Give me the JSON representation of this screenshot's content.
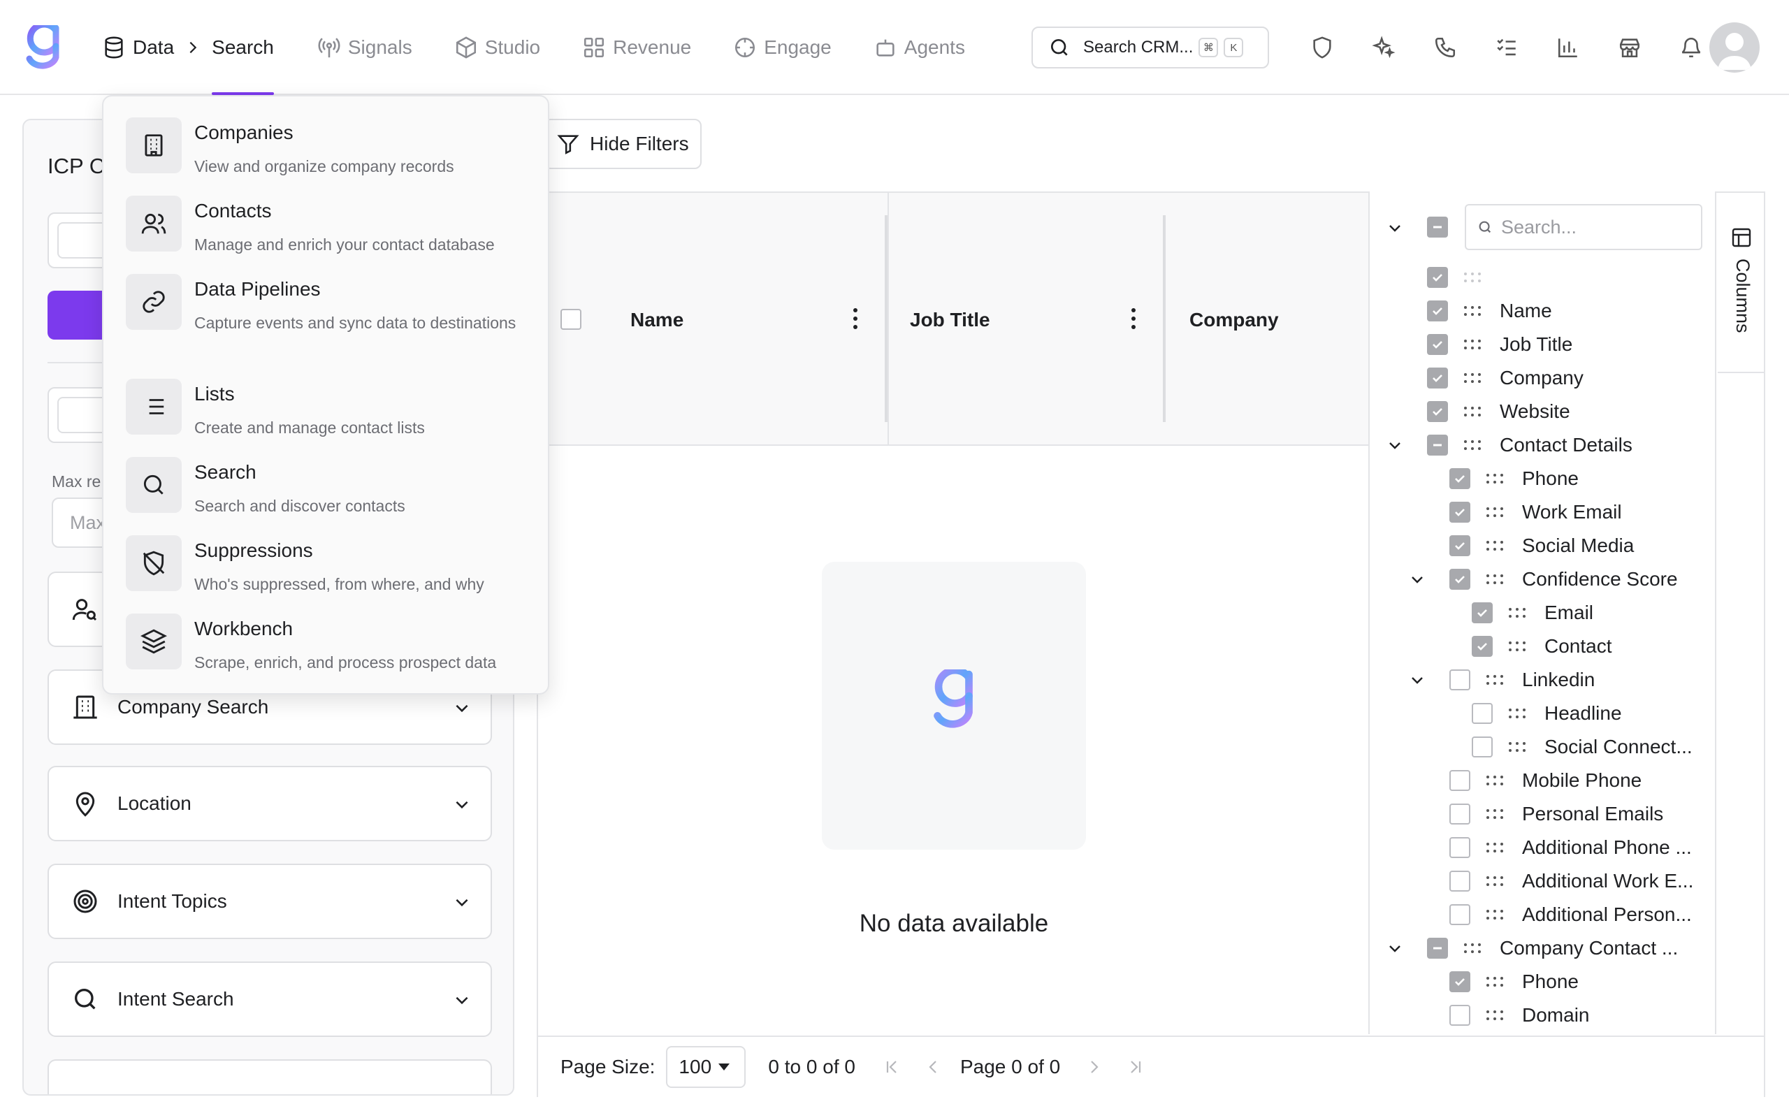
{
  "nav": {
    "data_label": "Data",
    "search_label": "Search",
    "signals_label": "Signals",
    "studio_label": "Studio",
    "revenue_label": "Revenue",
    "engage_label": "Engage",
    "agents_label": "Agents"
  },
  "global_search": {
    "placeholder": "Search CRM...",
    "key_cmd": "⌘",
    "key_k": "K"
  },
  "colors": {
    "accent": "#7c3aed"
  },
  "menu": {
    "items": [
      {
        "title": "Companies",
        "desc": "View and organize company records",
        "icon": "building-icon"
      },
      {
        "title": "Contacts",
        "desc": "Manage and enrich your contact database",
        "icon": "users-icon"
      },
      {
        "title": "Data Pipelines",
        "desc": "Capture events and sync data to destinations",
        "icon": "link-icon"
      },
      {
        "title": "Lists",
        "desc": "Create and manage contact lists",
        "icon": "list-icon"
      },
      {
        "title": "Search",
        "desc": "Search and discover contacts",
        "icon": "search-icon"
      },
      {
        "title": "Suppressions",
        "desc": "Who's suppressed, from where, and why",
        "icon": "shield-off-icon"
      },
      {
        "title": "Workbench",
        "desc": "Scrape, enrich, and process prospect data",
        "icon": "layers-icon"
      }
    ]
  },
  "filters": {
    "title": "ICP C",
    "max_label": "Max re",
    "max_placeholder": "Max",
    "company_search": "Company Search",
    "location": "Location",
    "intent_topics": "Intent Topics",
    "intent_search": "Intent Search"
  },
  "toolbar": {
    "hide_filters": "Hide Filters"
  },
  "grid": {
    "columns": [
      "Name",
      "Job Title",
      "Company"
    ],
    "empty_text": "No data available"
  },
  "pager": {
    "page_size_label": "Page Size:",
    "page_size": "100",
    "range": "0 to 0 of 0",
    "page": "Page 0 of 0"
  },
  "columns_panel": {
    "tab_label": "Columns",
    "search_placeholder": "Search...",
    "items": [
      {
        "label": "",
        "level": 0,
        "state": "on",
        "expand": false
      },
      {
        "label": "Name",
        "level": 0,
        "state": "on",
        "expand": false
      },
      {
        "label": "Job Title",
        "level": 0,
        "state": "on",
        "expand": false
      },
      {
        "label": "Company",
        "level": 0,
        "state": "on",
        "expand": false
      },
      {
        "label": "Website",
        "level": 0,
        "state": "on",
        "expand": false
      },
      {
        "label": "Contact Details",
        "level": 0,
        "state": "mix",
        "expand": true
      },
      {
        "label": "Phone",
        "level": 1,
        "state": "on",
        "expand": false
      },
      {
        "label": "Work Email",
        "level": 1,
        "state": "on",
        "expand": false
      },
      {
        "label": "Social Media",
        "level": 1,
        "state": "on",
        "expand": false
      },
      {
        "label": "Confidence Score",
        "level": 1,
        "state": "on",
        "expand": true
      },
      {
        "label": "Email",
        "level": 2,
        "state": "on",
        "expand": false
      },
      {
        "label": "Contact",
        "level": 2,
        "state": "on",
        "expand": false
      },
      {
        "label": "Linkedin",
        "level": 1,
        "state": "off",
        "expand": true
      },
      {
        "label": "Headline",
        "level": 2,
        "state": "off",
        "expand": false
      },
      {
        "label": "Social Connect...",
        "level": 2,
        "state": "off",
        "expand": false
      },
      {
        "label": "Mobile Phone",
        "level": 1,
        "state": "off",
        "expand": false
      },
      {
        "label": "Personal Emails",
        "level": 1,
        "state": "off",
        "expand": false
      },
      {
        "label": "Additional Phone ...",
        "level": 1,
        "state": "off",
        "expand": false
      },
      {
        "label": "Additional Work E...",
        "level": 1,
        "state": "off",
        "expand": false
      },
      {
        "label": "Additional Person...",
        "level": 1,
        "state": "off",
        "expand": false
      },
      {
        "label": "Company Contact ...",
        "level": 0,
        "state": "mix",
        "expand": true
      },
      {
        "label": "Phone",
        "level": 1,
        "state": "on",
        "expand": false
      },
      {
        "label": "Domain",
        "level": 1,
        "state": "off",
        "expand": false
      }
    ]
  }
}
